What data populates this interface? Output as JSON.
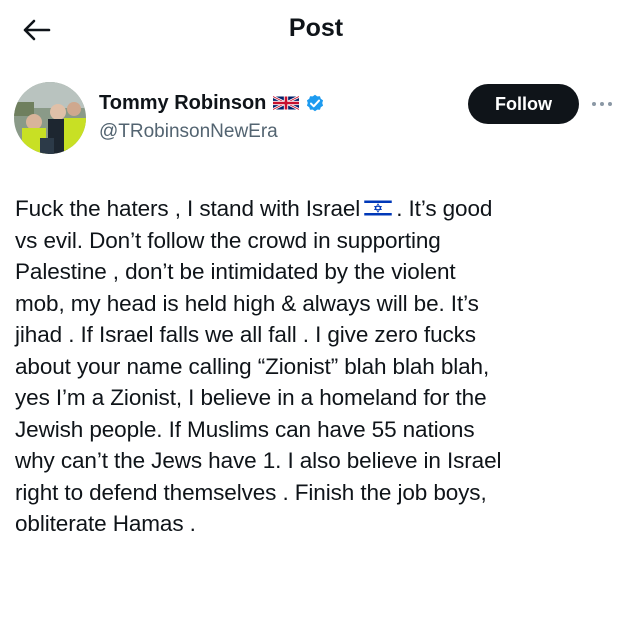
{
  "header": {
    "title": "Post",
    "back_icon": "arrow-left-icon"
  },
  "author": {
    "name": "Tommy Robinson",
    "handle": "@TRobinsonNewEra",
    "flag_icon": "uk-flag-icon",
    "verified_icon": "verified-badge-icon",
    "verified_color": "#1d9bf0"
  },
  "actions": {
    "follow_label": "Follow",
    "more_icon": "more-dots-icon"
  },
  "post": {
    "text_before_flag": "Fuck the haters , I stand with Israel",
    "flag_icon": "israel-flag-icon",
    "text_after_flag": ". It’s good\nvs evil. Don’t follow the crowd in supporting\nPalestine , don’t be intimidated by the violent\nmob, my head is held high & always will be. It’s\njihad . If Israel falls we all fall . I give zero fucks\nabout your name calling “Zionist” blah blah blah,\nyes I’m a Zionist, I believe in a homeland for the\nJewish people. If Muslims can have 55 nations\nwhy can’t the Jews have 1. I also believe in Israel\nright to defend themselves . Finish the job boys,\nobliterate Hamas ."
  }
}
